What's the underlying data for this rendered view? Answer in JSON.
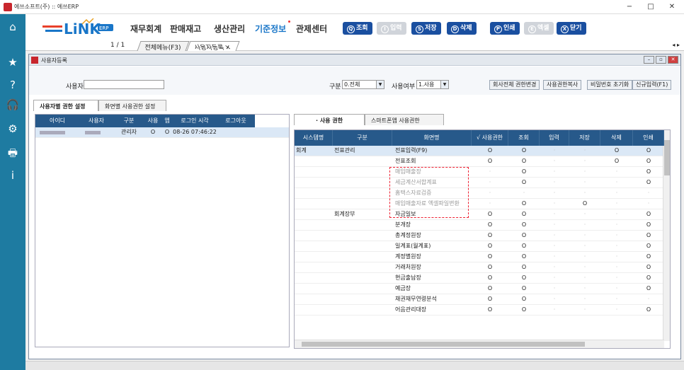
{
  "window": {
    "title": "에쓰소프트(주) :: 에쓰ERP",
    "min": "−",
    "max": "□",
    "close": "✕"
  },
  "sidebar": {
    "icons": [
      "home-icon",
      "star-icon",
      "help-icon",
      "headset-icon",
      "settings-icon",
      "printer-icon",
      "info-icon"
    ],
    "glyphs": [
      "⌂",
      "★",
      "?",
      "🎧",
      "⚙",
      "🖶",
      "i"
    ]
  },
  "header": {
    "logo_text": "LiNK",
    "logo_badge": "ERP",
    "menus": [
      "재무회계",
      "판매재고",
      "생산관리",
      "기준정보",
      "관제센터"
    ],
    "active_menu": "기준정보",
    "toolbar": [
      {
        "key": "Q",
        "label": "조회",
        "enabled": true
      },
      {
        "key": "I",
        "label": "입력",
        "enabled": false
      },
      {
        "key": "S",
        "label": "저장",
        "enabled": true
      },
      {
        "key": "D",
        "label": "삭제",
        "enabled": true
      },
      {
        "key": "P",
        "label": "인쇄",
        "enabled": true
      },
      {
        "key": "E",
        "label": "엑셀",
        "enabled": false
      },
      {
        "key": "X",
        "label": "닫기",
        "enabled": true
      }
    ]
  },
  "tabstrip": {
    "pager": "1 / 1",
    "tabs": [
      "전체메뉴(F3)",
      "사용자등록"
    ],
    "close_glyph": "✕",
    "nav": "◂ ▸"
  },
  "subwindow": {
    "title": "사용자등록"
  },
  "filter": {
    "user_label": "사용자",
    "user_value": "",
    "type_label": "구분",
    "type_value": "0.전체",
    "use_label": "사용여부",
    "use_value": "1.사용",
    "buttons": [
      "회사전체 권한변경",
      "사용권한복사",
      "비밀번호 초기화",
      "신규입력(F1)"
    ]
  },
  "left_tabs": [
    "사용자별 권한 설정",
    "화면별 사용권한 설정"
  ],
  "left_grid": {
    "columns": [
      "아이디",
      "사용자",
      "구분",
      "사용",
      "앱",
      "로그인 시각",
      "로그아웃"
    ],
    "rows": [
      {
        "id": "",
        "user": "",
        "type": "관리자",
        "use": "O",
        "app": "O",
        "login": "08-26 07:46:22",
        "logout": ""
      }
    ]
  },
  "right_tabs": [
    "· 사용 권한",
    "스마트폰앱 사용권한"
  ],
  "right_grid": {
    "columns": [
      "시스템명",
      "구분",
      "화면명",
      "√ 사용권한",
      "조회",
      "입력",
      "저장",
      "삭제",
      "인쇄"
    ],
    "rows": [
      {
        "sys": "회계",
        "cat": "전표관리",
        "screen": "전표입력(F9)",
        "use": "O",
        "q": "O",
        "i": "·",
        "s": "·",
        "d": "O",
        "p": "O",
        "dim": false,
        "sel": true
      },
      {
        "sys": "",
        "cat": "",
        "screen": "전표조회",
        "use": "O",
        "q": "O",
        "i": "·",
        "s": "·",
        "d": "O",
        "p": "O",
        "dim": false,
        "sel": false
      },
      {
        "sys": "",
        "cat": "",
        "screen": "매입매출장",
        "use": "·",
        "q": "O",
        "i": "·",
        "s": "·",
        "d": "·",
        "p": "O",
        "dim": true,
        "sel": false
      },
      {
        "sys": "",
        "cat": "",
        "screen": "세금계산서합계표",
        "use": "·",
        "q": "O",
        "i": "·",
        "s": "·",
        "d": "·",
        "p": "O",
        "dim": true,
        "sel": false
      },
      {
        "sys": "",
        "cat": "",
        "screen": "홈택스자료검증",
        "use": "·",
        "q": "·",
        "i": "·",
        "s": "·",
        "d": "·",
        "p": "·",
        "dim": true,
        "sel": false
      },
      {
        "sys": "",
        "cat": "",
        "screen": "매입매출자료 엑셀파일변환",
        "use": "·",
        "q": "O",
        "i": "·",
        "s": "O",
        "d": "·",
        "p": "·",
        "dim": true,
        "sel": false
      },
      {
        "sys": "",
        "cat": "회계장부",
        "screen": "자금일보",
        "use": "O",
        "q": "O",
        "i": "·",
        "s": "·",
        "d": "·",
        "p": "O",
        "dim": false,
        "sel": false
      },
      {
        "sys": "",
        "cat": "",
        "screen": "분개장",
        "use": "O",
        "q": "O",
        "i": "·",
        "s": "·",
        "d": "·",
        "p": "O",
        "dim": false,
        "sel": false
      },
      {
        "sys": "",
        "cat": "",
        "screen": "총계정원장",
        "use": "O",
        "q": "O",
        "i": "·",
        "s": "·",
        "d": "·",
        "p": "O",
        "dim": false,
        "sel": false
      },
      {
        "sys": "",
        "cat": "",
        "screen": "일계표(월계표)",
        "use": "O",
        "q": "O",
        "i": "·",
        "s": "·",
        "d": "·",
        "p": "O",
        "dim": false,
        "sel": false
      },
      {
        "sys": "",
        "cat": "",
        "screen": "계정별원장",
        "use": "O",
        "q": "O",
        "i": "·",
        "s": "·",
        "d": "·",
        "p": "O",
        "dim": false,
        "sel": false
      },
      {
        "sys": "",
        "cat": "",
        "screen": "거래처원장",
        "use": "O",
        "q": "O",
        "i": "·",
        "s": "·",
        "d": "·",
        "p": "O",
        "dim": false,
        "sel": false
      },
      {
        "sys": "",
        "cat": "",
        "screen": "현금출납장",
        "use": "O",
        "q": "O",
        "i": "·",
        "s": "·",
        "d": "·",
        "p": "O",
        "dim": false,
        "sel": false
      },
      {
        "sys": "",
        "cat": "",
        "screen": "예금장",
        "use": "O",
        "q": "O",
        "i": "·",
        "s": "·",
        "d": "·",
        "p": "O",
        "dim": false,
        "sel": false
      },
      {
        "sys": "",
        "cat": "",
        "screen": "채권채무연령분석",
        "use": "O",
        "q": "O",
        "i": "·",
        "s": "·",
        "d": "·",
        "p": "·",
        "dim": false,
        "sel": false
      },
      {
        "sys": "",
        "cat": "",
        "screen": "어음관리대장",
        "use": "O",
        "q": "O",
        "i": "·",
        "s": "·",
        "d": "·",
        "p": "O",
        "dim": false,
        "sel": false
      }
    ]
  },
  "colors": {
    "sidebar": "#1e7ba1",
    "grid_header": "#27598a",
    "toolbar_btn": "#1a4fa0",
    "accent": "#1976c8",
    "highlight": "#e23333"
  }
}
